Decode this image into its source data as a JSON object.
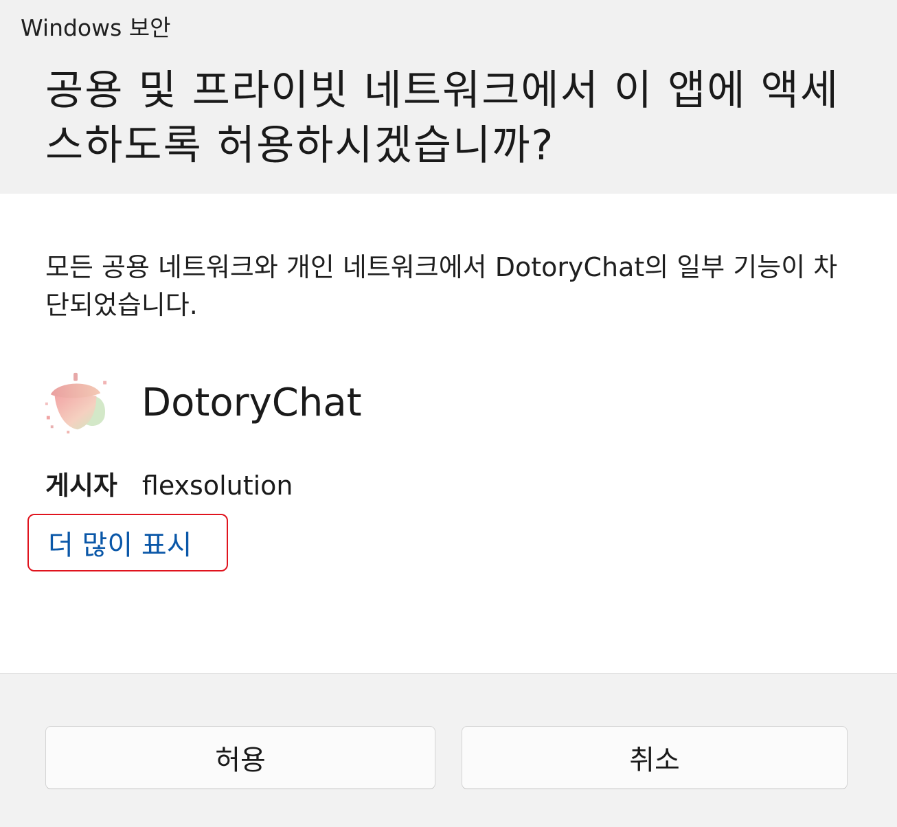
{
  "window": {
    "title": "Windows 보안"
  },
  "header": {
    "headline": "공용 및 프라이빗 네트워크에서 이 앱에 액세스하도록 허용하시겠습니까?"
  },
  "content": {
    "description": "모든 공용 네트워크와 개인 네트워크에서 DotoryChat의 일부 기능이 차단되었습니다.",
    "app": {
      "name": "DotoryChat",
      "icon": "acorn-icon"
    },
    "publisher": {
      "label": "게시자",
      "value": "flexsolution"
    },
    "more_link": "더 많이 표시"
  },
  "footer": {
    "allow_label": "허용",
    "cancel_label": "취소"
  },
  "colors": {
    "link": "#0a57a8",
    "highlight_border": "#e0141e",
    "footer_bg": "#f2f2f2",
    "header_bg": "#f1f1f1"
  }
}
